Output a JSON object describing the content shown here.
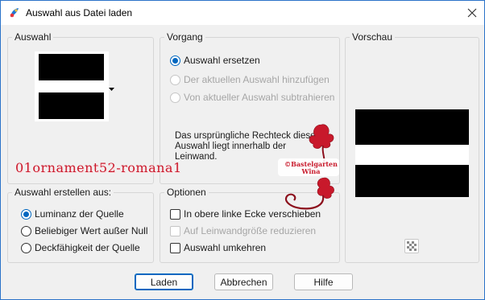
{
  "window": {
    "title": "Auswahl aus Datei laden",
    "close_icon": "close-icon",
    "app_icon": "paintshop-icon"
  },
  "auswahl": {
    "title": "Auswahl",
    "selector_icon": "dropdown-arrow-icon"
  },
  "vorgang": {
    "title": "Vorgang",
    "options": [
      {
        "label": "Auswahl ersetzen",
        "checked": true,
        "enabled": true
      },
      {
        "label": "Der aktuellen Auswahl hinzufügen",
        "checked": false,
        "enabled": false
      },
      {
        "label": "Von aktueller Auswahl subtrahieren",
        "checked": false,
        "enabled": false
      }
    ],
    "info": "Das ursprüngliche Rechteck dieser Auswahl liegt innerhalb der Leinwand."
  },
  "vorschau": {
    "title": "Vorschau",
    "toggle_icon": "checkerboard-icon"
  },
  "erstellen": {
    "title": "Auswahl erstellen aus:",
    "options": [
      {
        "label": "Luminanz der Quelle",
        "checked": true
      },
      {
        "label": "Beliebiger Wert außer Null",
        "checked": false
      },
      {
        "label": "Deckfähigkeit der Quelle",
        "checked": false
      }
    ]
  },
  "optionen": {
    "title": "Optionen",
    "options": [
      {
        "label": "In obere linke Ecke verschieben",
        "checked": false,
        "enabled": true
      },
      {
        "label": "Auf Leinwandgröße reduzieren",
        "checked": false,
        "enabled": false
      },
      {
        "label": "Auswahl umkehren",
        "checked": false,
        "enabled": true
      }
    ]
  },
  "buttons": {
    "load": "Laden",
    "cancel": "Abbrechen",
    "help": "Hilfe"
  },
  "overlay": {
    "watermark_text": "01ornament52-romana1",
    "stamp_line1": "©Bastelgarten",
    "stamp_line2": "Wina"
  }
}
